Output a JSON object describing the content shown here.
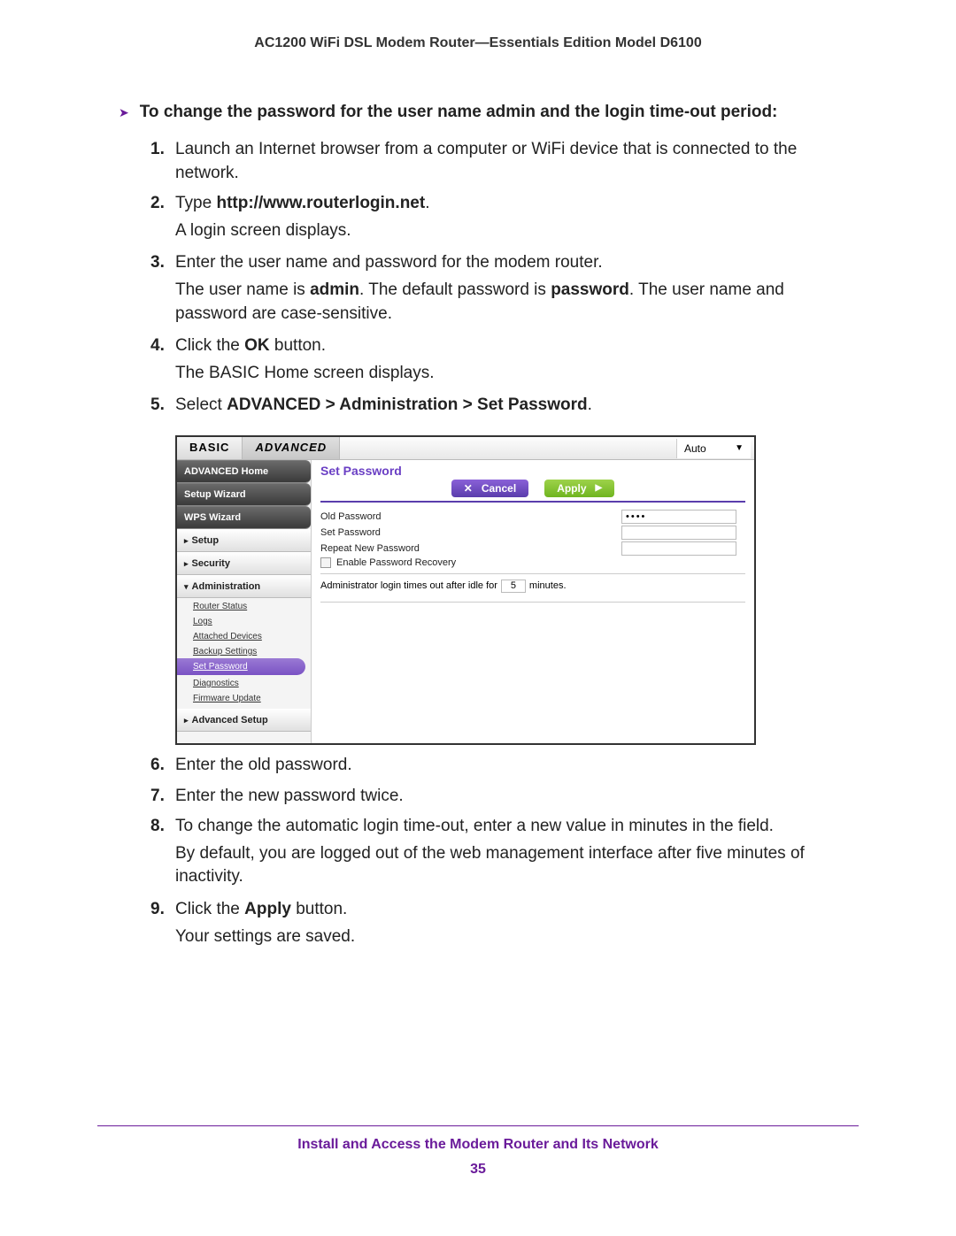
{
  "doc_header": "AC1200 WiFi DSL Modem Router—Essentials Edition Model D6100",
  "lead": "To change the password for the user name admin and the login time-out period:",
  "steps": {
    "s1": "Launch an Internet browser from a computer or WiFi device that is connected to the network.",
    "s2_prefix": "Type ",
    "s2_bold": "http://www.routerlogin.net",
    "s2_suffix": ".",
    "s2_b": "A login screen displays.",
    "s3": "Enter the user name and password for the modem router.",
    "s3_b_a": "The user name is ",
    "s3_b_b": "admin",
    "s3_b_c": ". The default password is ",
    "s3_b_d": "password",
    "s3_b_e": ". The user name and password are case-sensitive.",
    "s4_a": "Click the ",
    "s4_b": "OK",
    "s4_c": " button.",
    "s4_d": "The BASIC Home screen displays.",
    "s5_a": "Select ",
    "s5_b": "ADVANCED > Administration > Set Password",
    "s5_c": ".",
    "s6": "Enter the old password.",
    "s7": "Enter the new password twice.",
    "s8": "To change the automatic login time-out, enter a new value in minutes in the field.",
    "s8_b": "By default, you are logged out of the web management interface after five minutes of inactivity.",
    "s9_a": "Click the ",
    "s9_b": "Apply",
    "s9_c": " button.",
    "s9_d": "Your settings are saved."
  },
  "screenshot": {
    "tab_basic": "BASIC",
    "tab_advanced": "ADVANCED",
    "auto": "Auto",
    "sidebar": {
      "advanced_home": "ADVANCED Home",
      "setup_wizard": "Setup Wizard",
      "wps_wizard": "WPS Wizard",
      "setup": "Setup",
      "security": "Security",
      "administration": "Administration",
      "subs": {
        "router_status": "Router Status",
        "logs": "Logs",
        "attached_devices": "Attached Devices",
        "backup_settings": "Backup Settings",
        "set_password": "Set Password",
        "diagnostics": "Diagnostics",
        "firmware_update": "Firmware Update"
      },
      "advanced_setup": "Advanced Setup"
    },
    "panel": {
      "title": "Set Password",
      "cancel": "Cancel",
      "apply": "Apply",
      "old_password": "Old Password",
      "set_password": "Set Password",
      "repeat_new": "Repeat New Password",
      "enable_recovery": "Enable Password Recovery",
      "timeout_a": "Administrator login times out after idle for",
      "timeout_value": "5",
      "timeout_b": "minutes.",
      "old_password_value": "••••"
    }
  },
  "footer": {
    "text": "Install and Access the Modem Router and Its Network",
    "page": "35"
  }
}
